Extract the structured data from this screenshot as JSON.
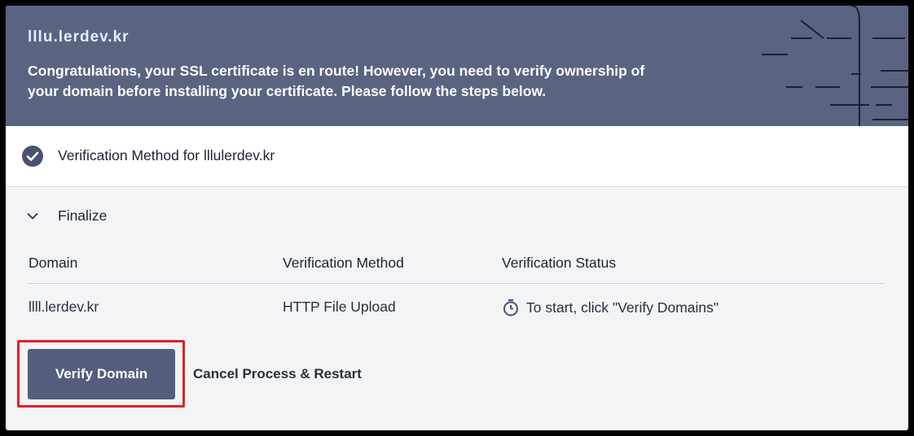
{
  "banner": {
    "domain_title": "lllu.lerdev.kr",
    "message": "Congratulations, your SSL certificate is en route! However, you need to verify ownership of your domain before installing your certificate. Please follow the steps below."
  },
  "method": {
    "label": "Verification Method for ",
    "domain": "lllulerdev.kr"
  },
  "finalize": {
    "label": "Finalize",
    "columns": [
      "Domain",
      "Verification Method",
      "Verification Status"
    ],
    "rows": [
      {
        "domain": "llll.lerdev.kr",
        "method": "HTTP File Upload",
        "status": "To start, click \"Verify Domains\""
      }
    ]
  },
  "actions": {
    "verify_label": "Verify Domain",
    "cancel_label": "Cancel Process & Restart"
  },
  "colors": {
    "banner": "#5a6380",
    "button": "#555d7c",
    "highlight": "#e0202a"
  }
}
